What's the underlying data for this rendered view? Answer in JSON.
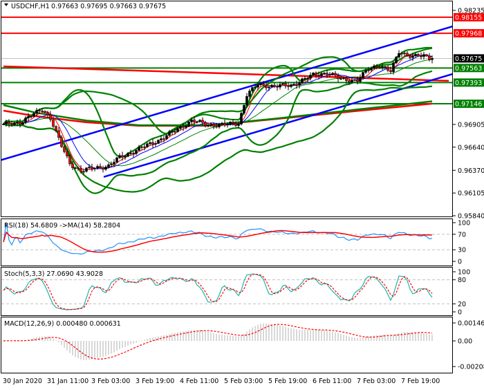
{
  "header": {
    "menu_icon": "triangle-down-icon",
    "symbol": "USDCHF,H1",
    "ohlc": "0.97663 0.97695 0.97663 0.97675"
  },
  "indicators": {
    "rsi_label": "RSI(18) 54.6809  ->MA(14) 58.2804",
    "stoch_label": "Stoch(5,3,3) 27.0690 43.9028",
    "macd_label": "MACD(12,26,9) 0.000480 0.000631"
  },
  "colors": {
    "bull": "#000000",
    "bear": "#ff0000",
    "red_line": "#ff0000",
    "green_line": "#008000",
    "blue_line": "#0000ff",
    "current_price_box": "#000000",
    "rsi": "#1e90ff",
    "stoch": "#20b2aa"
  },
  "chart_data": [
    {
      "type": "candlestick",
      "title": "USDCHF,H1",
      "ylim": [
        0.9584,
        0.98235
      ],
      "y_ticks": [
        "0.98235",
        "0.96905",
        "0.96640",
        "0.96370",
        "0.96105",
        "0.95840"
      ],
      "x_tick_labels": [
        "30 Jan 2020",
        "31 Jan 11:00",
        "3 Feb 03:00",
        "3 Feb 19:00",
        "4 Feb 11:00",
        "5 Feb 03:00",
        "5 Feb 19:00",
        "6 Feb 11:00",
        "7 Feb 03:00",
        "7 Feb 19:00"
      ],
      "bars_between_x_ticks": 16,
      "bar_count": 156,
      "close_path": [
        [
          0,
          0.969
        ],
        [
          6,
          0.9693
        ],
        [
          14,
          0.9708
        ],
        [
          17,
          0.9698
        ],
        [
          21,
          0.9665
        ],
        [
          24,
          0.9645
        ],
        [
          28,
          0.9636
        ],
        [
          33,
          0.964
        ],
        [
          38,
          0.9642
        ],
        [
          42,
          0.9652
        ],
        [
          49,
          0.9662
        ],
        [
          56,
          0.9672
        ],
        [
          62,
          0.9683
        ],
        [
          68,
          0.9695
        ],
        [
          74,
          0.969
        ],
        [
          80,
          0.969
        ],
        [
          85,
          0.9692
        ],
        [
          88,
          0.9725
        ],
        [
          92,
          0.9737
        ],
        [
          98,
          0.9735
        ],
        [
          104,
          0.9736
        ],
        [
          112,
          0.9748
        ],
        [
          117,
          0.9751
        ],
        [
          122,
          0.9743
        ],
        [
          128,
          0.9742
        ],
        [
          132,
          0.9755
        ],
        [
          136,
          0.976
        ],
        [
          140,
          0.9752
        ],
        [
          143,
          0.9775
        ],
        [
          148,
          0.977
        ],
        [
          152,
          0.977
        ],
        [
          155,
          0.97675
        ]
      ],
      "current_price": "0.97675",
      "levels": [
        {
          "price": "0.98155",
          "color": "red"
        },
        {
          "price": "0.97968",
          "color": "red"
        },
        {
          "price": "0.97563",
          "color": "green"
        },
        {
          "price": "0.97393",
          "color": "green"
        },
        {
          "price": "0.97146",
          "color": "green"
        }
      ],
      "trend_lines": [
        {
          "name": "channel-upper",
          "from": [
            -1.25,
            0.96486
          ],
          "to": [
            162.5,
            0.98049
          ]
        },
        {
          "name": "channel-lower",
          "from": [
            36.25,
            0.96293
          ],
          "to": [
            162.5,
            0.97494
          ]
        }
      ],
      "long_mas": [
        {
          "name": "ma-slow-red",
          "color": "red",
          "points": [
            [
              0,
              0.97582
            ],
            [
              80,
              0.975
            ],
            [
              161,
              0.97413
            ]
          ]
        },
        {
          "name": "ma-long-red",
          "color": "red",
          "points": [
            [
              0,
              0.97066
            ],
            [
              12,
              0.97
            ],
            [
              30,
              0.9693
            ],
            [
              49,
              0.96889
            ],
            [
              74,
              0.96889
            ],
            [
              99,
              0.9697
            ],
            [
              124,
              0.9705
            ],
            [
              155,
              0.97147
            ]
          ]
        },
        {
          "name": "ma-long-green",
          "color": "green",
          "points": [
            [
              0,
              0.9713
            ],
            [
              12,
              0.9704
            ],
            [
              30,
              0.9695
            ],
            [
              49,
              0.96895
            ],
            [
              74,
              0.96895
            ],
            [
              99,
              0.96975
            ],
            [
              124,
              0.97065
            ],
            [
              155,
              0.97175
            ]
          ]
        }
      ]
    },
    {
      "type": "line",
      "title": "RSI(18)",
      "ylim": [
        0,
        100
      ],
      "y_ticks": [
        "100",
        "70",
        "30",
        "0"
      ],
      "levels": [
        70,
        30
      ],
      "value": 54.6809,
      "ma_value": 58.2804
    },
    {
      "type": "line",
      "title": "Stoch(5,3,3)",
      "ylim": [
        0,
        100
      ],
      "y_ticks": [
        "100",
        "80",
        "20",
        "0"
      ],
      "levels": [
        80,
        20
      ],
      "main": 27.069,
      "signal": 43.9028
    },
    {
      "type": "bar",
      "title": "MACD(12,26,9)",
      "ylim": [
        -0.002082,
        0.00146
      ],
      "y_ticks": [
        "0.00146",
        "0.00",
        "-0.002082"
      ],
      "main": 0.00048,
      "signal": 0.000631
    }
  ]
}
